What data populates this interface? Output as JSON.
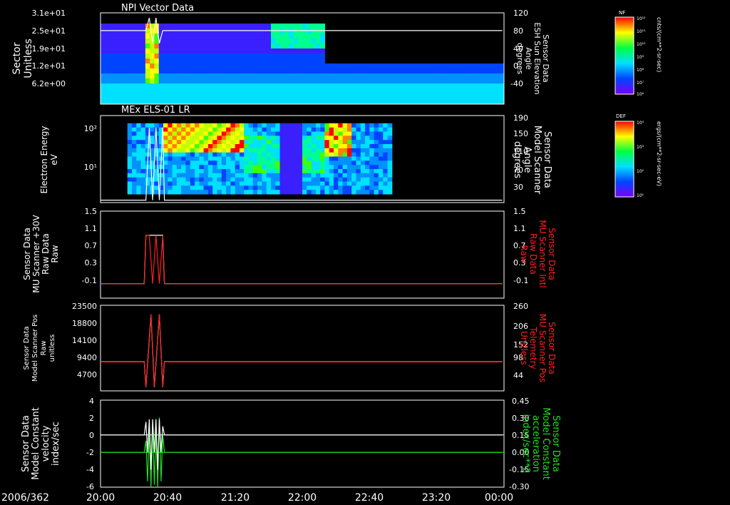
{
  "date_label": "2006/362",
  "x_ticks": [
    "20:00",
    "20:40",
    "21:20",
    "22:00",
    "22:40",
    "23:20",
    "00:00"
  ],
  "colors": {
    "white": "#ffffff",
    "red": "#ff2020",
    "green": "#20e020",
    "frame": "#ffffff"
  },
  "panel1": {
    "title": "NPI Vector Data",
    "ylabel_left": [
      "Sector",
      "Unitless"
    ],
    "yticks_left": [
      "3.1e+01",
      "2.5e+01",
      "1.9e+01",
      "1.2e+01",
      "6.2e+00"
    ],
    "ylabel_right": [
      "Sensor Data",
      "ESH Sun Elevation",
      "Angle",
      "degrees"
    ],
    "yticks_right": [
      "120",
      "80",
      "40",
      "0",
      "-40"
    ],
    "colorbar_label": "NF",
    "colorbar_ticks": [
      "10¹²",
      "10¹¹",
      "10¹⁰",
      "10⁹",
      "10⁸",
      "10⁷",
      "10⁶"
    ],
    "colorbar_units": "cnts/(cm**2-sr-sec)"
  },
  "panel2": {
    "title": "MEx ELS-01 LR",
    "ylabel_left": [
      "Electron Energy",
      "eV"
    ],
    "yticks_left": [
      "10²",
      "10¹"
    ],
    "ylabel_right": [
      "Sensor Data",
      "Model Scanner",
      "Angle",
      "degrees"
    ],
    "yticks_right": [
      "190",
      "150",
      "110",
      "70",
      "30"
    ],
    "colorbar_label": "DEF",
    "colorbar_ticks": [
      "10⁴",
      "10³",
      "10²",
      "10¹"
    ],
    "colorbar_units": "ergs/(cm**2-sr-sec-eV)"
  },
  "panel3": {
    "ylabel_left": [
      "Sensor Data",
      "MU Scanner +30V",
      "Raw Data",
      "Raw"
    ],
    "yticks_left": [
      "1.5",
      "1.1",
      "0.7",
      "0.3",
      "-0.1"
    ],
    "ylabel_right": [
      "Sensor Data",
      "MU Scanner Intl",
      "Raw Data",
      "Raw"
    ],
    "yticks_right": [
      "1.5",
      "1.1",
      "0.7",
      "0.3",
      "-0.1"
    ]
  },
  "panel4": {
    "ylabel_left": [
      "Sensor Data",
      "Model Scanner Pos",
      "Raw",
      "unitless"
    ],
    "yticks_left": [
      "23500",
      "18800",
      "14100",
      "9400",
      "4700"
    ],
    "ylabel_right": [
      "Sensor Data",
      "MU Scanner Pos",
      "Telemetry",
      "Unitless"
    ],
    "yticks_right": [
      "260",
      "206",
      "152",
      "98",
      "44"
    ]
  },
  "panel5": {
    "ylabel_left": [
      "Sensor Data",
      "Model Constant",
      "velocity",
      "index/sec"
    ],
    "yticks_left": [
      "4",
      "2",
      "0",
      "-2",
      "-4",
      "-6"
    ],
    "ylabel_right": [
      "Sensor Data",
      "Model Constant",
      "acceleration",
      "index/sec**2"
    ],
    "yticks_right": [
      "0.45",
      "0.30",
      "0.15",
      "0.00",
      "-0.15",
      "-0.30"
    ]
  },
  "chart_data": [
    {
      "type": "heatmap",
      "title": "NPI Vector Data",
      "xlabel": "",
      "x_range": [
        "20:00",
        "00:00"
      ],
      "ylabel": "Sector Unitless",
      "ylim": [
        0,
        31
      ],
      "y2label": "Sensor Data ESH Sun Elevation Angle degrees",
      "y2lim": [
        -60,
        120
      ],
      "colorbar": {
        "label": "NF",
        "range": [
          1000000.0,
          1000000000000.0
        ],
        "log": true,
        "units": "cnts/(cm**2-sr-sec)"
      },
      "series": [
        {
          "name": "ESH Sun Elevation",
          "color": "#ffffff",
          "x": [
            "20:00",
            "20:27",
            "20:29",
            "20:31",
            "20:33",
            "20:35",
            "20:37",
            "21:00",
            "23:59"
          ],
          "y": [
            85,
            85,
            110,
            60,
            110,
            60,
            85,
            85,
            85
          ]
        }
      ]
    },
    {
      "type": "heatmap",
      "title": "MEx ELS-01 LR",
      "xlabel": "",
      "x_range": [
        "20:00",
        "00:00"
      ],
      "ylabel": "Electron Energy eV",
      "ylim": [
        1,
        200
      ],
      "log_y": true,
      "y2label": "Sensor Data Model Scanner Angle degrees",
      "y2lim": [
        10,
        190
      ],
      "colorbar": {
        "label": "DEF",
        "range": [
          10.0,
          10000.0
        ],
        "log": true,
        "units": "ergs/(cm**2-sr-sec-eV)"
      },
      "series": [
        {
          "name": "Model Scanner Angle",
          "color": "#ffffff",
          "x": [
            "20:00",
            "20:27",
            "20:29",
            "20:31",
            "20:33",
            "20:35",
            "20:37",
            "20:38",
            "23:59"
          ],
          "y": [
            15,
            15,
            165,
            15,
            165,
            15,
            165,
            15,
            15
          ]
        }
      ]
    },
    {
      "type": "line",
      "xlabel": "",
      "x_range": [
        "20:00",
        "00:00"
      ],
      "ylabel": "Sensor Data MU Scanner +30V Raw Data Raw",
      "ylim": [
        -0.3,
        1.5
      ],
      "y2label": "Sensor Data MU Scanner Intl Raw Data Raw",
      "y2lim": [
        -0.3,
        1.5
      ],
      "series": [
        {
          "name": "MU Scanner +30V",
          "color": "#ffffff",
          "x": [
            "20:00",
            "20:26",
            "20:27",
            "20:37",
            "20:38",
            "23:59"
          ],
          "y": [
            0,
            0,
            1,
            1,
            0,
            0
          ]
        },
        {
          "name": "MU Scanner Intl",
          "color": "#ff2020",
          "x": [
            "20:00",
            "20:26",
            "20:27",
            "20:29",
            "20:31",
            "20:33",
            "20:35",
            "20:37",
            "20:38",
            "23:59"
          ],
          "y": [
            0,
            0,
            1,
            1,
            0,
            1,
            0,
            1,
            0,
            0
          ]
        }
      ]
    },
    {
      "type": "line",
      "xlabel": "",
      "x_range": [
        "20:00",
        "00:00"
      ],
      "ylabel": "Sensor Data Model Scanner Pos Raw unitless",
      "ylim": [
        0,
        23500
      ],
      "y2label": "Sensor Data MU Scanner Pos Telemetry Unitless",
      "y2lim": [
        0,
        260
      ],
      "series": [
        {
          "name": "Model Scanner Pos",
          "color": "#ffffff",
          "x": [
            "20:00",
            "20:26",
            "20:27",
            "20:30",
            "20:32",
            "20:35",
            "20:37",
            "20:38",
            "23:59"
          ],
          "y": [
            8000,
            8000,
            1000,
            21000,
            1000,
            21000,
            1000,
            8000,
            8000
          ]
        },
        {
          "name": "MU Scanner Pos",
          "color": "#ff2020",
          "x": [
            "20:00",
            "20:26",
            "20:27",
            "20:30",
            "20:32",
            "20:35",
            "20:37",
            "20:38",
            "23:59"
          ],
          "y": [
            88,
            88,
            11,
            232,
            11,
            232,
            11,
            88,
            88
          ]
        }
      ]
    },
    {
      "type": "line",
      "xlabel": "",
      "x_range": [
        "20:00",
        "00:00"
      ],
      "ylabel": "Sensor Data Model Constant velocity index/sec",
      "ylim": [
        -6,
        4
      ],
      "y2label": "Sensor Data Model Constant acceleration index/sec**2",
      "y2lim": [
        -0.3,
        0.45
      ],
      "series": [
        {
          "name": "Model Constant velocity",
          "color": "#ffffff",
          "x": [
            "20:00",
            "20:26",
            "20:27",
            "20:28",
            "20:29",
            "20:30",
            "20:31",
            "20:32",
            "20:33",
            "20:34",
            "20:35",
            "20:36",
            "20:37",
            "20:38",
            "23:59"
          ],
          "y": [
            0,
            0,
            1.5,
            -2,
            1.8,
            -4,
            1.8,
            -2,
            1.8,
            -4,
            1.8,
            -2,
            1,
            0,
            0
          ]
        },
        {
          "name": "Model Constant acceleration",
          "color": "#20e020",
          "x": [
            "20:00",
            "20:26",
            "20:27",
            "20:28",
            "20:29",
            "20:30",
            "20:31",
            "20:32",
            "20:33",
            "20:34",
            "20:35",
            "20:36",
            "20:37",
            "20:38",
            "23:59"
          ],
          "y": [
            0,
            0,
            0.1,
            -0.25,
            0.2,
            -0.3,
            0.25,
            -0.28,
            0.2,
            -0.3,
            0.3,
            -0.25,
            0.15,
            0,
            0
          ]
        }
      ]
    }
  ]
}
